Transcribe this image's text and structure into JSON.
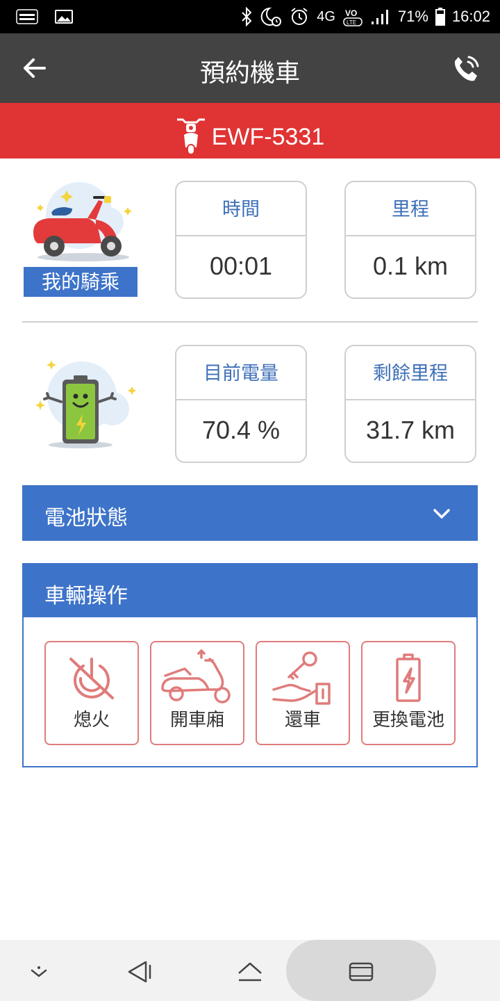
{
  "status_bar": {
    "network": "4G",
    "volte": "VoLTE",
    "battery_percent": "71%",
    "time": "16:02",
    "icons": [
      "app-logo-icon",
      "image-icon",
      "bluetooth-icon",
      "do-not-disturb-icon",
      "alarm-icon",
      "signal-icon",
      "battery-icon"
    ]
  },
  "app_bar": {
    "title": "預約機車",
    "back_icon": "arrow-left-icon",
    "call_icon": "phone-call-icon"
  },
  "plate": {
    "number": "EWF-5331",
    "icon": "scooter-front-icon"
  },
  "my_ride": {
    "label": "我的騎乘",
    "time": {
      "label": "時間",
      "value": "00:01"
    },
    "mileage": {
      "label": "里程",
      "value": "0.1 km"
    }
  },
  "battery": {
    "current": {
      "label": "目前電量",
      "value": "70.4 %"
    },
    "remaining_range": {
      "label": "剩餘里程",
      "value": "31.7 km"
    }
  },
  "battery_status_section": {
    "title": "電池狀態",
    "expand_icon": "chevron-down-icon"
  },
  "vehicle_ops": {
    "title": "車輛操作",
    "buttons": [
      {
        "label": "熄火",
        "icon": "ignition-off-icon"
      },
      {
        "label": "開車廂",
        "icon": "open-trunk-icon"
      },
      {
        "label": "還車",
        "icon": "return-key-icon"
      },
      {
        "label": "更換電池",
        "icon": "battery-swap-icon"
      }
    ]
  },
  "nav_bar": {
    "icons": [
      "hide-keyboard-icon",
      "back-nav-icon",
      "home-nav-icon",
      "recents-nav-icon"
    ]
  },
  "colors": {
    "app_bar": "#434343",
    "plate_bar": "#e03333",
    "accent_blue": "#3d73c9",
    "label_blue": "#3d6fb8",
    "op_border": "#e07b7b"
  }
}
